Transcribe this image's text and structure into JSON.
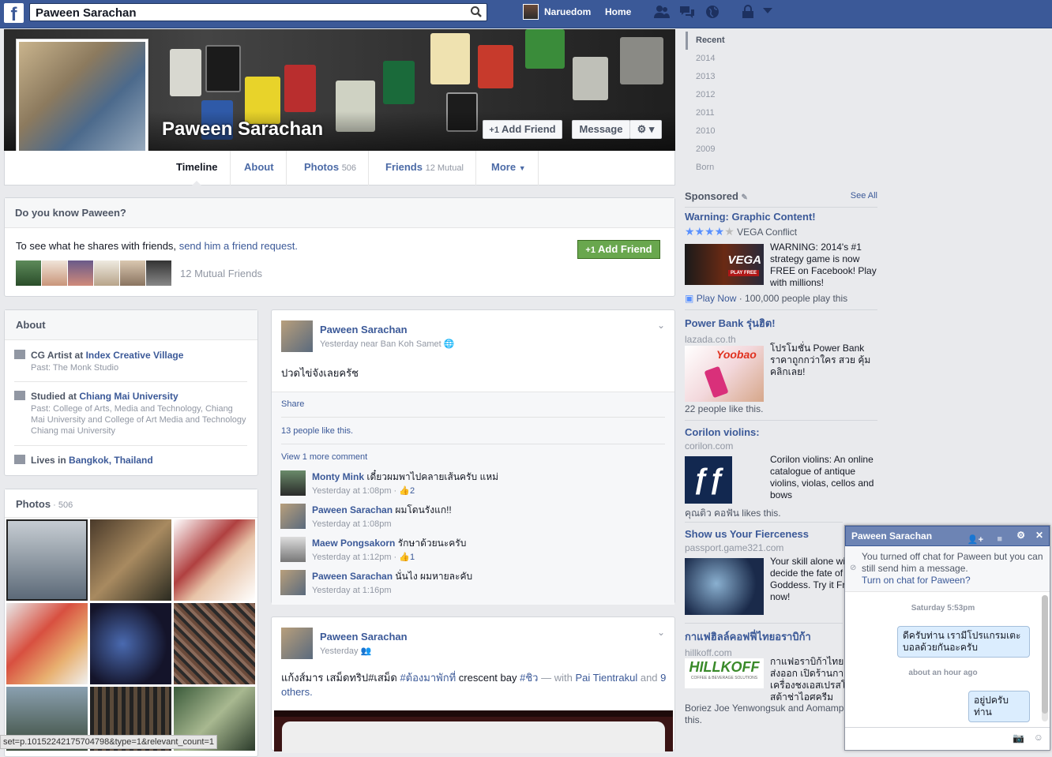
{
  "topbar": {
    "search_value": "Paween Sarachan",
    "user_name": "Naruedom",
    "home_label": "Home"
  },
  "profile": {
    "name": "Paween Sarachan",
    "add_friend": "Add Friend",
    "message": "Message"
  },
  "tabs": [
    {
      "label": "Timeline",
      "count": ""
    },
    {
      "label": "About",
      "count": ""
    },
    {
      "label": "Photos",
      "count": "506"
    },
    {
      "label": "Friends",
      "count": "12 Mutual"
    },
    {
      "label": "More",
      "count": ""
    }
  ],
  "know": {
    "title": "Do you know Paween?",
    "text_pre": "To see what he shares with friends,",
    "text_link": "send him a friend request.",
    "mutual": "12 Mutual Friends",
    "button": "Add Friend"
  },
  "about": {
    "title": "About",
    "work": {
      "pre": "CG Artist at",
      "place": "Index Creative Village",
      "past": "Past: The Monk Studio"
    },
    "study": {
      "pre": "Studied at",
      "place": "Chiang Mai University",
      "past": "Past: College of Arts, Media and Technology, Chiang Mai University and College of Art Media and Technology Chiang mai University"
    },
    "lives": {
      "pre": "Lives in",
      "place": "Bangkok, Thailand"
    }
  },
  "photos": {
    "title": "Photos",
    "count": "506"
  },
  "post1": {
    "author": "Paween Sarachan",
    "meta": "Yesterday near Ban Koh Samet",
    "text": "ปวดไข่จังเลยครัช",
    "share": "Share",
    "likes": "13 people like this.",
    "view_more": "View 1 more comment",
    "comments": [
      {
        "name": "Monty Mink",
        "text": "เดี๋ยวผมพาไปคลายเส้นครับ แหม่",
        "time": "Yesterday at 1:08pm",
        "likes": "2"
      },
      {
        "name": "Paween Sarachan",
        "text": "ผมโดนรังแก!!",
        "time": "Yesterday at 1:08pm",
        "likes": ""
      },
      {
        "name": "Maew Pongsakorn",
        "text": "รักษาด้วยนะครับ",
        "time": "Yesterday at 1:12pm",
        "likes": "1"
      },
      {
        "name": "Paween Sarachan",
        "text": "นั่นไง ผมหายละคับ",
        "time": "Yesterday at 1:16pm",
        "likes": ""
      }
    ]
  },
  "post2": {
    "author": "Paween Sarachan",
    "meta": "Yesterday",
    "text_pre": "แก้งส์มาร เสม็ดทริป#เสม็ด",
    "tag1": "#ต้องมาพักที่",
    "text_mid": "crescent bay",
    "tag2": "#ชิว",
    "with": "— with",
    "with_name": "Pai Tientrakul",
    "and": "and",
    "others": "9 others."
  },
  "timeline_years": [
    "Recent",
    "2014",
    "2013",
    "2012",
    "2011",
    "2010",
    "2009",
    "Born"
  ],
  "sponsored": {
    "title": "Sponsored",
    "see_all": "See All",
    "ads": [
      {
        "title": "Warning: Graphic Content!",
        "source": "VEGA Conflict",
        "text": "WARNING: 2014's #1 strategy game is now FREE on Facebook! Play with millions!",
        "footer_link": "Play Now",
        "footer": "· 100,000 people play this",
        "logo_text": "VEGA",
        "badge": "PLAY FREE"
      },
      {
        "title": "Power Bank รุ่นฮิต!",
        "source": "lazada.co.th",
        "text": "โปรโมชั่น Power Bank ราคาถูกกว่าใคร สวย คุ้ม คลิกเลย!",
        "footer": "22 people like this.",
        "logo_text": "Yoobao"
      },
      {
        "title": "Corilon violins:",
        "source": "corilon.com",
        "text": "Corilon violins: An online catalogue of antique violins, violas, cellos and bows",
        "footer": "คุณติว คอฟัน likes this."
      },
      {
        "title": "Show us Your Fierceness",
        "source": "passport.game321.com",
        "text": "Your skill alone will decide the fate of Goddess. Try it Free now!"
      },
      {
        "title": "กาแฟฮิลล์คอฟฟี่ไทยอราบิก้า",
        "source": "hillkoff.com",
        "text": "กาแฟอราบิก้าไทยคุณภาพ ส่งออก เปิดร้านกาแฟ เครื่องชงเอสเปรสโซ บาริสต้าช่าไอศครีม",
        "footer": "Boriez Joe Yenwongsuk and Aomamp like this.",
        "logo_text": "HILLKOFF",
        "logo_sub": "COFFEE & BEVERAGE SOLUTIONS"
      }
    ]
  },
  "chat": {
    "name": "Paween Sarachan",
    "notice": "You turned off chat for Paween but you can still send him a message.",
    "notice_link": "Turn on chat for Paween?",
    "time1": "Saturday 5:53pm",
    "msg1": "ดีครับท่าน เรามีโปรแกรมเตะบอลด้วยกันอะครับ",
    "time2": "about an hour ago",
    "msg2": "อยู่ปครับท่าน"
  },
  "statusbar": "set=p.10152242175704798&type=1&relevant_count=1"
}
